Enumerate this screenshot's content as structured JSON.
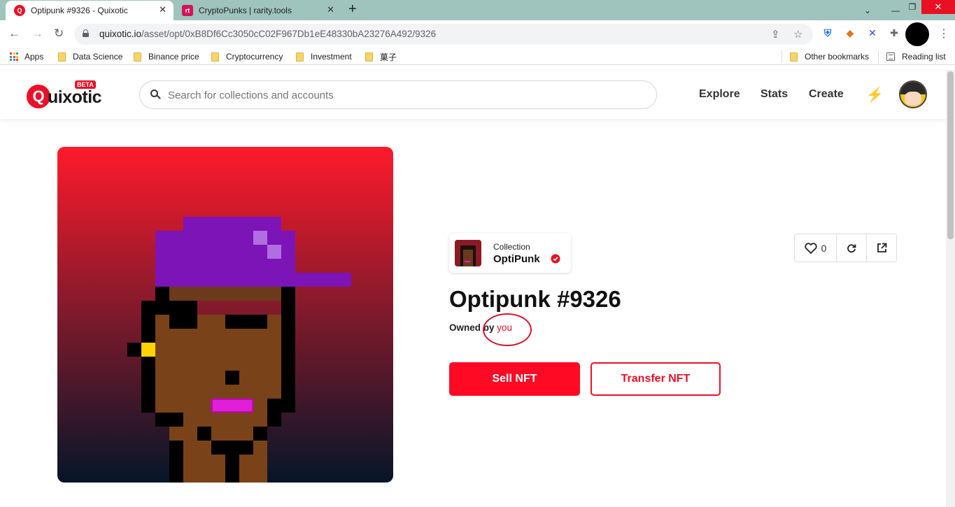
{
  "browser": {
    "tabs": [
      {
        "title": "Optipunk #9326 - Quixotic",
        "favicon_color": "#ea1028",
        "favicon_glyph": "Q"
      },
      {
        "title": "CryptoPunks | rarity.tools",
        "favicon_color": "#d4145a",
        "favicon_glyph": "rt"
      }
    ],
    "url_host": "quixotic.io",
    "url_path": "/asset/opt/0xB8Df6Cc3050cC02F967Db1eE48330bA23276A492/9326",
    "bookmarks": [
      "Apps",
      "Data Science",
      "Binance price",
      "Cryptocurrency",
      "Investment",
      "菓子"
    ],
    "other_bookmarks": "Other bookmarks",
    "reading_list": "Reading list"
  },
  "site": {
    "logo_text": "uixotic",
    "logo_q": "Q",
    "beta_badge": "BETA",
    "search_placeholder": "Search for collections and accounts",
    "nav": [
      "Explore",
      "Stats",
      "Create"
    ]
  },
  "asset": {
    "collection_label": "Collection",
    "collection_name": "OptiPunk",
    "title": "Optipunk #9326",
    "owned_by_prefix": "Owned by",
    "owner": "you",
    "like_count": "0",
    "sell_label": "Sell NFT",
    "transfer_label": "Transfer NFT"
  },
  "colors": {
    "brand": "#ea1028",
    "sell_button": "#ff0a24",
    "tabstrip": "#9fc4bd"
  },
  "icons": [
    "heart-icon",
    "refresh-icon",
    "share-icon",
    "bolt-icon",
    "search-icon",
    "verified-icon"
  ]
}
